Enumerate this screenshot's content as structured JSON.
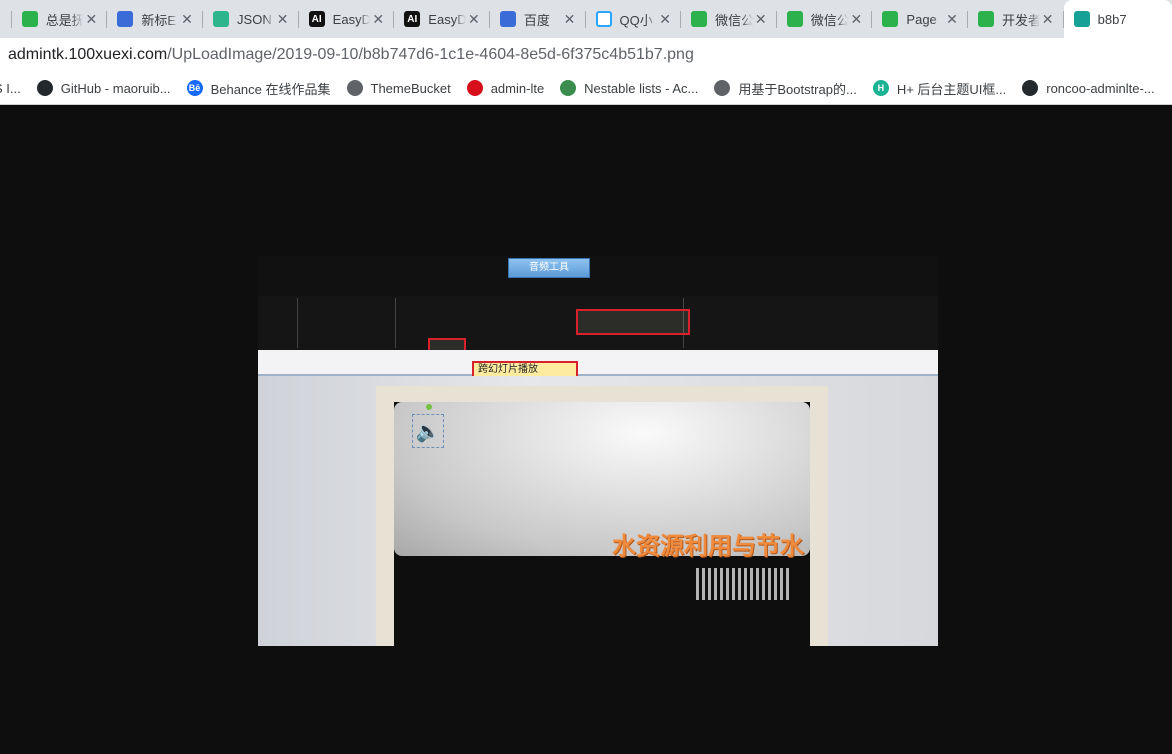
{
  "tabs": [
    {
      "title": "总是抚",
      "icon": "wechat-icon"
    },
    {
      "title": "新标E",
      "icon": "paw-icon"
    },
    {
      "title": "JSON",
      "icon": "json-icon"
    },
    {
      "title": "EasyD",
      "icon": "ai-icon",
      "glyph": "AI"
    },
    {
      "title": "EasyD",
      "icon": "ai-icon",
      "glyph": "AI"
    },
    {
      "title": "百度",
      "icon": "paw-icon"
    },
    {
      "title": "QQ小",
      "icon": "qq-icon"
    },
    {
      "title": "微信公",
      "icon": "wechat-icon"
    },
    {
      "title": "微信公",
      "icon": "wechat-icon"
    },
    {
      "title": "Page",
      "icon": "wechat-icon"
    },
    {
      "title": "开发者",
      "icon": "wechat-icon"
    },
    {
      "title": "b8b7",
      "icon": "image-icon"
    }
  ],
  "address": {
    "host": "admintk.100xuexi.com",
    "path": "/UpLoadImage/2019-09-10/b8b747d6-1c1e-4604-8e5d-6f375c4b51b7.png"
  },
  "bookmarks": [
    {
      "label": "S I...",
      "icon": "generic-icon"
    },
    {
      "label": "GitHub - maoruib...",
      "icon": "github-icon"
    },
    {
      "label": "Behance 在线作品集",
      "icon": "behance-icon",
      "glyph": "Bē"
    },
    {
      "label": "ThemeBucket",
      "icon": "globe-icon"
    },
    {
      "label": "admin-lte",
      "icon": "adminlte-icon"
    },
    {
      "label": "Nestable lists - Ac...",
      "icon": "nestable-icon"
    },
    {
      "label": "用基于Bootstrap的...",
      "icon": "globe-icon"
    },
    {
      "label": "H+ 后台主题UI框...",
      "icon": "hplus-icon",
      "glyph": "H"
    },
    {
      "label": "roncoo-adminlte-...",
      "icon": "github-icon"
    }
  ],
  "screenshot": {
    "context_tab": "音频工具",
    "dropdown_item": "跨幻灯片播放",
    "slide_title": "水资源利用与节水"
  },
  "colors": {
    "page_bg": "#0e0e0e",
    "highlight": "#d9212b",
    "title_orange": "#f08a3c"
  }
}
